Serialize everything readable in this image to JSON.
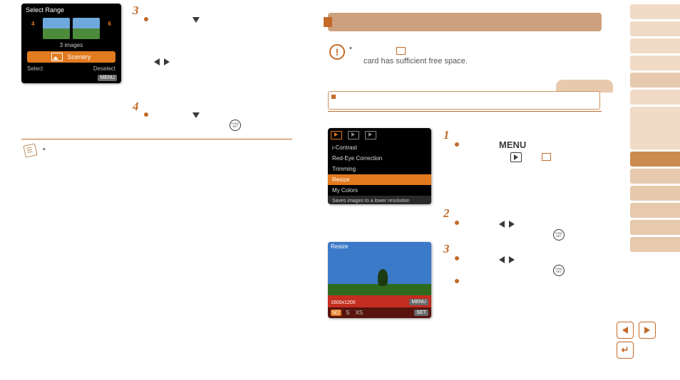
{
  "lcd1": {
    "title": "Select Range",
    "numLeft": "4",
    "numRight": "6",
    "count": "3 images",
    "tag": "Scenery",
    "select": "Select",
    "deselect": "Deselect",
    "menu": "MENU"
  },
  "left": {
    "step3": "3",
    "step4": "4"
  },
  "right": {
    "warn": "card has sufficient free space.",
    "step1": "1",
    "menuLabel": "MENU",
    "step2": "2",
    "step3": "3"
  },
  "lcd2": {
    "items": [
      "i-Contrast",
      "Red-Eye Correction",
      "Trimming",
      "Resize",
      "My Colors"
    ],
    "desc": "Saves images to a lower resolution"
  },
  "lcd3": {
    "title": "Resize",
    "res": "1600x1200",
    "menu": "MENU",
    "sizes": [
      "M2",
      "S",
      "XS"
    ],
    "set": "SET"
  }
}
